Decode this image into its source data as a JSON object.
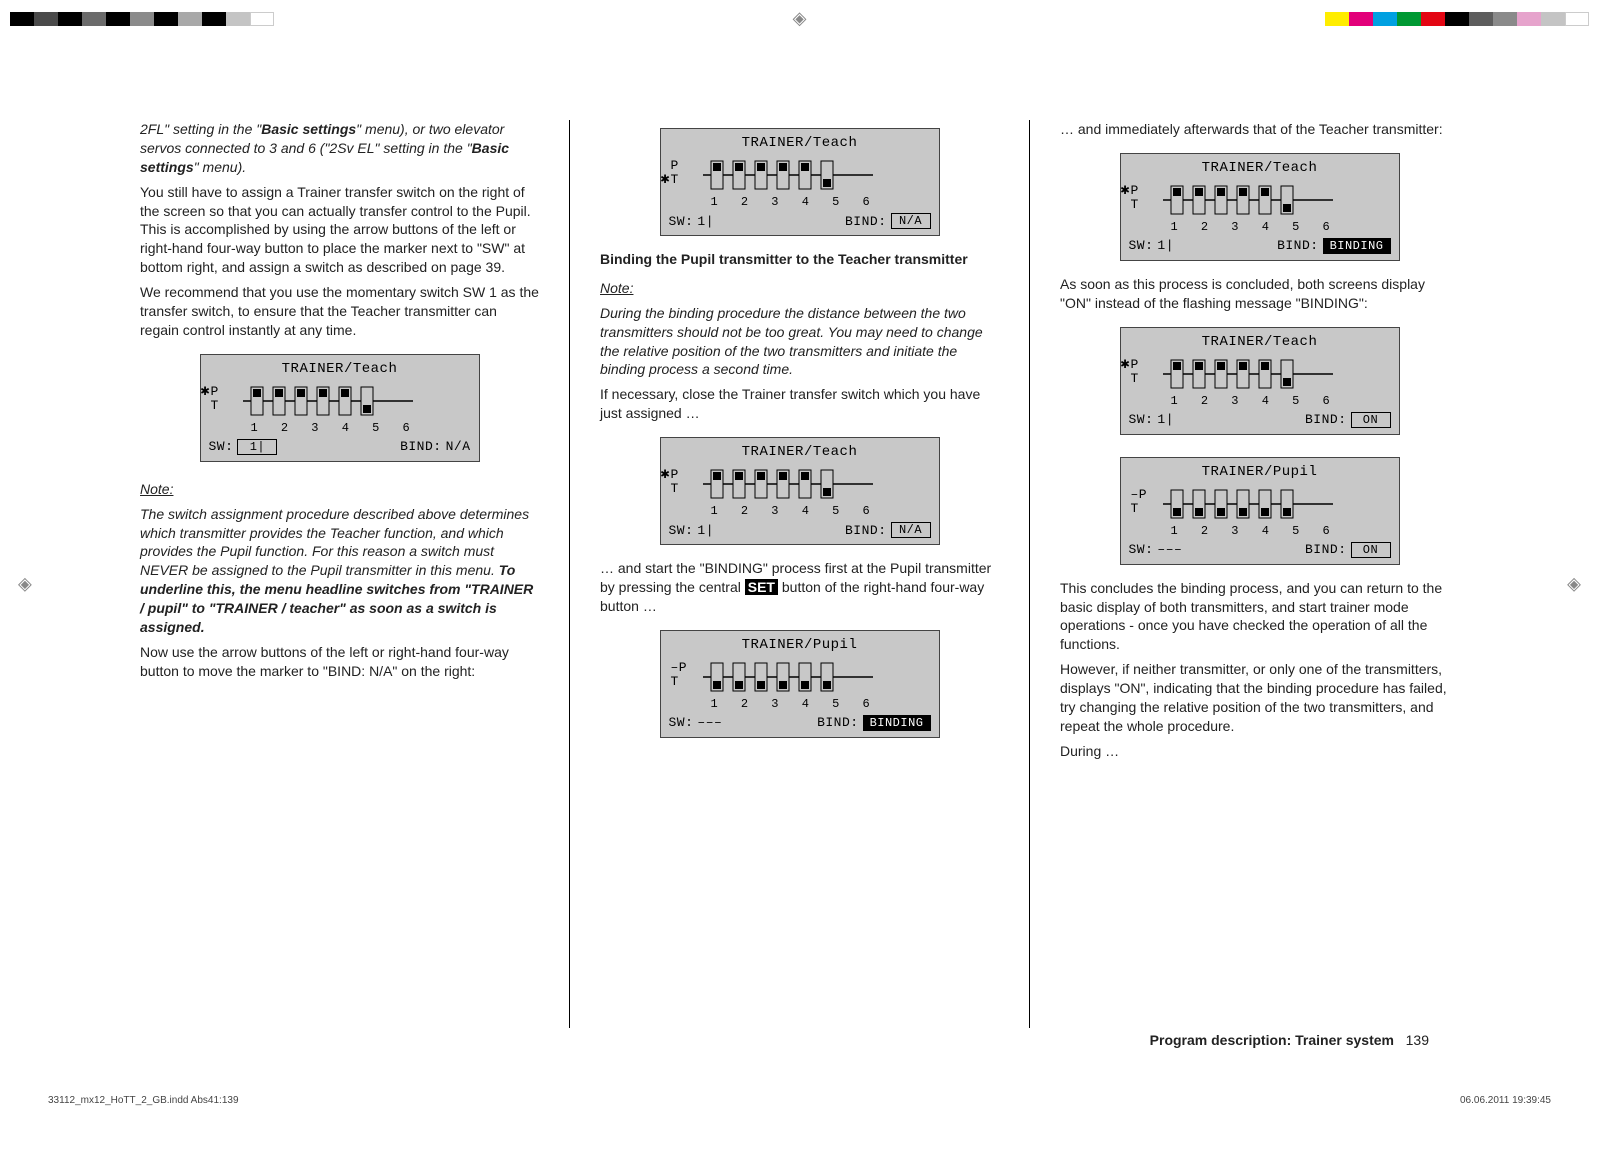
{
  "col1": {
    "p1a": "2FL\" setting in the \"",
    "p1b": "Basic settings",
    "p1c": "\" menu), or two elevator servos connected to 3 and 6 (\"2Sv EL\" setting in the \"",
    "p1d": "Basic settings",
    "p1e": "\" menu).",
    "p2": "You still have to assign a Trainer transfer switch on the right of the screen so that you can actually transfer control to the Pupil. This is accomplished by using the arrow buttons of the left or right-hand four-way button to place the marker next to \"SW\" at bottom right, and assign a switch as described on page 39.",
    "p3": "We recommend that you use the momentary switch SW 1 as the transfer switch, to ensure that the Teacher transmitter can regain control instantly at any time.",
    "lcd1": {
      "title": "TRAINER/Teach",
      "ast_on": "P",
      "p": "P",
      "t": "T",
      "nums": "1 2 3 4 5 6",
      "sw_label": "SW:",
      "sw_val": "1|",
      "sw_box": true,
      "bind_label": "BIND:",
      "bind_val": "N/A",
      "bind_box": false
    },
    "note_head": "Note:",
    "note_body_a": "The switch assignment procedure described above determines which transmitter provides the Teacher function, and which provides the Pupil function. For this reason a switch must NEVER be assigned to the Pupil transmitter in this menu. ",
    "note_body_b": "To underline this, the menu headline switches from \"TRAINER / pupil\" to \"TRAINER / teacher\" as soon as a switch is assigned.",
    "p4": "Now use the arrow buttons of the left or right-hand four-way button to move the marker to \"BIND: N/A\" on the right:"
  },
  "col2": {
    "lcd2": {
      "title": "TRAINER/Teach",
      "ast_on": "T",
      "p": "P",
      "t": "T",
      "nums": "1 2 3 4 5 6",
      "sw_label": "SW:",
      "sw_val": "1|",
      "sw_box": false,
      "bind_label": "BIND:",
      "bind_val": "N/A",
      "bind_box": true
    },
    "h1": "Binding the Pupil transmitter to the Teacher transmitter",
    "note_head": "Note:",
    "note_body": "During the binding procedure the distance between the two transmitters should not be too great. You may need to change the relative position of the two transmitters and initiate the binding process a second time.",
    "p1": "If necessary, close the Trainer transfer switch which you have just assigned …",
    "lcd3": {
      "title": "TRAINER/Teach",
      "ast_on": "P",
      "p": "P",
      "t": "T",
      "nums": "1 2 3 4 5 6",
      "sw_label": "SW:",
      "sw_val": "1|",
      "sw_box": false,
      "bind_label": "BIND:",
      "bind_val": "N/A",
      "bind_box": true
    },
    "p2a": "… and start the \"BINDING\" process first at the Pupil transmitter by pressing the central ",
    "p2b": "SET",
    "p2c": " button of the right-hand four-way button …",
    "lcd4": {
      "title": "TRAINER/Pupil",
      "ast_on": "",
      "p": "–P",
      "t": "T",
      "nums": "1 2 3 4 5 6",
      "sw_label": "SW:",
      "sw_val": "–––",
      "sw_box": false,
      "bind_label": "BIND:",
      "bind_val": "BINDING",
      "bind_box": true,
      "bind_inv": true
    }
  },
  "col3": {
    "p1": "… and immediately afterwards that of the Teacher transmitter:",
    "lcd5": {
      "title": "TRAINER/Teach",
      "ast_on": "P",
      "p": "P",
      "t": "T",
      "nums": "1 2 3 4 5 6",
      "sw_label": "SW:",
      "sw_val": "1|",
      "sw_box": false,
      "bind_label": "BIND:",
      "bind_val": "BINDING",
      "bind_box": true,
      "bind_inv": true
    },
    "p2": "As soon as this process is concluded, both screens display \"ON\" instead of the flashing message \"BINDING\":",
    "lcd6": {
      "title": "TRAINER/Teach",
      "ast_on": "P",
      "p": "P",
      "t": "T",
      "nums": "1 2 3 4 5 6",
      "sw_label": "SW:",
      "sw_val": "1|",
      "sw_box": false,
      "bind_label": "BIND:",
      "bind_val": "ON",
      "bind_box": true
    },
    "lcd7": {
      "title": "TRAINER/Pupil",
      "ast_on": "",
      "p": "–P",
      "t": "T",
      "nums": "1 2 3 4 5 6",
      "sw_label": "SW:",
      "sw_val": "–––",
      "sw_box": false,
      "bind_label": "BIND:",
      "bind_val": "ON",
      "bind_box": true
    },
    "p3": "This concludes the binding process, and you can return to the basic display of both transmitters, and start trainer mode operations - once you have checked the operation of all the functions.",
    "p4": "However, if neither transmitter, or only one of the transmitters, displays \"ON\", indicating that the binding procedure has failed, try changing the relative position of the two transmitters, and repeat the whole procedure.",
    "p5": "During …"
  },
  "footer": {
    "section": "Program description: Trainer system",
    "page": "139",
    "file": "33112_mx12_HoTT_2_GB.indd   Abs41:139",
    "stamp": "06.06.2011   19:39:45"
  },
  "colors": {
    "top_left": [
      "#000",
      "#4a4a4a",
      "#000",
      "#6b6b6b",
      "#000",
      "#8a8a8a",
      "#000",
      "#a8a8a8",
      "#000",
      "#c4c4c4",
      "#fff"
    ],
    "top_right": [
      "#ffed00",
      "#e2007a",
      "#00a0e1",
      "#009933",
      "#e30613",
      "#000",
      "#5d5d5d",
      "#8a8a8a",
      "#e6a3cc",
      "#c4c4c4",
      "#fff"
    ]
  },
  "switch_config": {
    "teach_ast_p": {
      "up": [
        1,
        1,
        1,
        1,
        1,
        0
      ],
      "down": [
        0,
        0,
        0,
        0,
        0,
        1
      ]
    },
    "teach_ast_t": {
      "up": [
        1,
        1,
        1,
        1,
        1,
        0
      ],
      "down": [
        0,
        0,
        0,
        0,
        0,
        1
      ]
    },
    "pupil": {
      "up": [
        0,
        0,
        0,
        0,
        0,
        0
      ],
      "down": [
        1,
        1,
        1,
        1,
        1,
        1
      ]
    }
  }
}
